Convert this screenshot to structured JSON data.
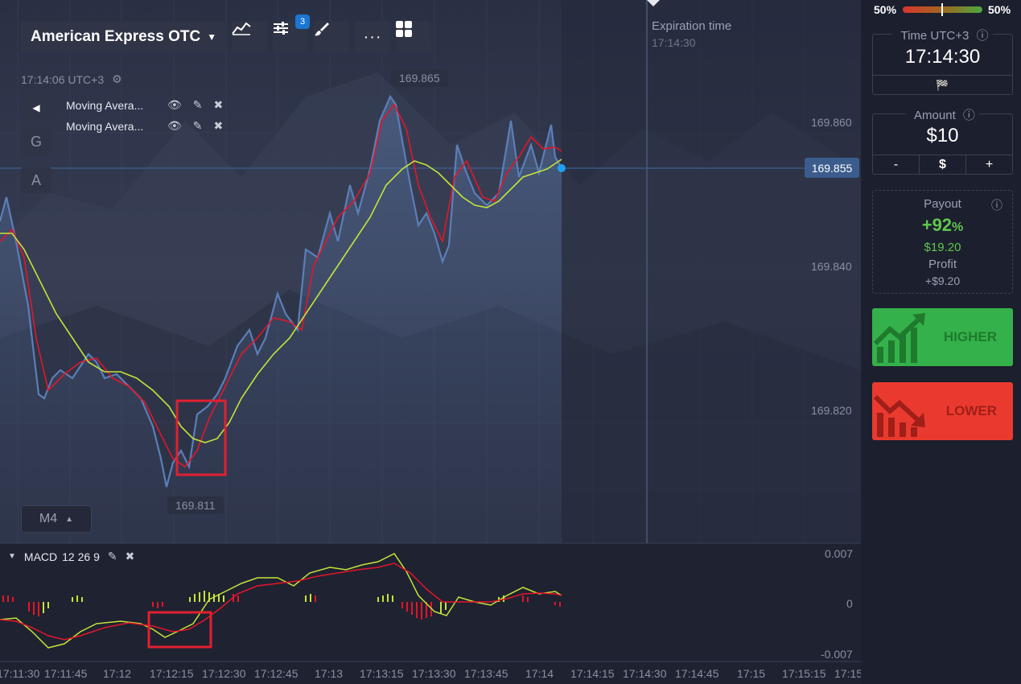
{
  "header": {
    "asset": "American Express OTC",
    "settings_badge": "3",
    "server_time": "17:14:06 UTC+3"
  },
  "indicators": [
    {
      "name": "Moving Avera..."
    },
    {
      "name": "Moving Avera..."
    }
  ],
  "side_buttons": {
    "g": "G",
    "a": "A"
  },
  "chart": {
    "high_tag": "169.865",
    "low_tag": "169.811",
    "current_price": "169.855",
    "price_axis": [
      "169.860",
      "169.840",
      "169.820"
    ],
    "expiration_label": "Expiration time",
    "expiration_time": "17:14:30",
    "timeframe": "M4",
    "colors": {
      "price_line": "#5b7fb8",
      "ma_red": "#e3162a",
      "ma_yellow": "#c4e33a",
      "accent": "#1ea1f1"
    }
  },
  "macd": {
    "label": "MACD",
    "params": "12 26 9",
    "axis": [
      "0.007",
      "0",
      "-0.007"
    ]
  },
  "time_axis": [
    "17:11:30",
    "17:11:45",
    "17:12",
    "17:12:15",
    "17:12:30",
    "17:12:45",
    "17:13",
    "17:13:15",
    "17:13:30",
    "17:13:45",
    "17:14",
    "17:14:15",
    "17:14:30",
    "17:14:45",
    "17:15",
    "17:15:15",
    "17:15"
  ],
  "sentiment": {
    "left": "50%",
    "right": "50%",
    "left_color": "#d9352e",
    "right_color": "#4aa83d"
  },
  "time_box": {
    "title": "Time UTC+3",
    "value": "17:14:30"
  },
  "amount_box": {
    "title": "Amount",
    "value": "$10",
    "minus": "-",
    "currency": "$",
    "plus": "+"
  },
  "payout_box": {
    "title": "Payout",
    "percent": "+92",
    "percent_sign": "%",
    "amount": "$19.20",
    "profit_label": "Profit",
    "profit_value": "+$9.20"
  },
  "higher_button": {
    "label": "HIGHER",
    "color": "#34b14a"
  },
  "lower_button": {
    "label": "LOWER",
    "color": "#ea3a2f"
  }
}
